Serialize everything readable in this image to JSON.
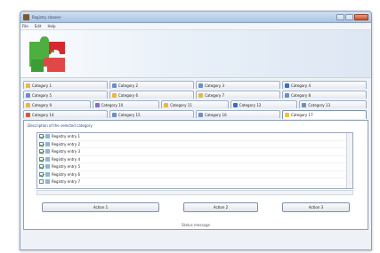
{
  "window": {
    "title": "Registry cleaner",
    "controls": {
      "minimize_icon": "minimize-icon",
      "maximize_icon": "maximize-icon",
      "close_icon": "close-icon"
    }
  },
  "menu": [
    "File",
    "Edit",
    "Help"
  ],
  "tabs": {
    "row1": [
      "Category 1",
      "Category 2",
      "Category 3",
      "Category 4"
    ],
    "row2": [
      "Category 5",
      "Category 6",
      "Category 7",
      "Category 8"
    ],
    "row3": [
      "Category 9",
      "Category 10",
      "Category 11",
      "Category 12",
      "Category 13"
    ],
    "row4": [
      "Category 14",
      "Category 15",
      "Category 16",
      "Category 17"
    ]
  },
  "panel": {
    "description": "Description of the selected category",
    "items": [
      {
        "label": "Registry entry 1",
        "checked": true
      },
      {
        "label": "Registry entry 2",
        "checked": true
      },
      {
        "label": "Registry entry 3",
        "checked": true
      },
      {
        "label": "Registry entry 4",
        "checked": true
      },
      {
        "label": "Registry entry 5",
        "checked": true
      },
      {
        "label": "Registry entry 6",
        "checked": true
      },
      {
        "label": "Registry entry 7",
        "checked": false
      }
    ]
  },
  "buttons": {
    "left": "Action 1",
    "middle": "Action 2",
    "right": "Action 3"
  },
  "status_text": "Status message",
  "colors": {
    "accent": "#2b4a7a",
    "tab_active_icon": "#f2c23a",
    "checkmark": "#1e8b2a"
  }
}
